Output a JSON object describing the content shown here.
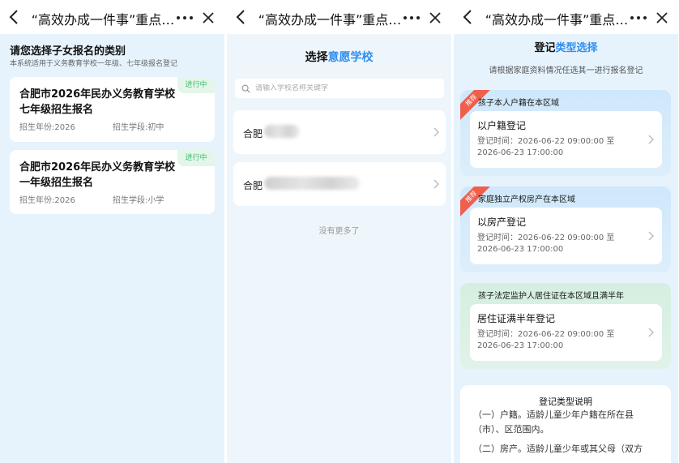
{
  "nav": {
    "title": "“高效办成一件事”重点…"
  },
  "icons": {
    "back": "chevron-left-icon",
    "more": "more-dots-icon",
    "close": "close-icon",
    "search": "search-icon",
    "chevron": "chevron-right-icon"
  },
  "colors": {
    "accent": "#2e8df0",
    "status_green": "#3dbb6a",
    "recommend_red": "#ef5f4c"
  },
  "panel1": {
    "heading": "请您选择子女报名的类别",
    "subheading": "本系统适用于义务教育学校一年级、七年级报名登记",
    "cards": [
      {
        "title": "合肥市2026年民办义务教育学校七年级招生报名",
        "status": "进行中",
        "year": "招生年份:2026",
        "stage": "招生学段:初中"
      },
      {
        "title": "合肥市2026年民办义务教育学校一年级招生报名",
        "status": "进行中",
        "year": "招生年份:2026",
        "stage": "招生学段:小学"
      }
    ]
  },
  "panel2": {
    "title_prefix": "选择",
    "title_highlight": "意愿学校",
    "search_placeholder": "请输入学校名称关键字",
    "schools": [
      {
        "label": "合肥"
      },
      {
        "label": "合肥"
      }
    ],
    "no_more": "没有更多了"
  },
  "panel3": {
    "title_prefix": "登记",
    "title_highlight": "类型选择",
    "subtitle": "请根据家庭资料情况任选其一进行报名登记",
    "options": [
      {
        "header": "孩子本人户籍在本区域",
        "badge": "推荐",
        "name": "以户籍登记",
        "time": "登记时间：2026-06-22 09:00:00 至 2026-06-23 17:00:00"
      },
      {
        "header": "家庭独立产权房产在本区域",
        "badge": "推荐",
        "name": "以房产登记",
        "time": "登记时间：2026-06-22 09:00:00 至 2026-06-23 17:00:00"
      },
      {
        "header": "孩子法定监护人居住证在本区域且满半年",
        "badge": "",
        "name": "居住证满半年登记",
        "time": "登记时间：2026-06-22 09:00:00 至 2026-06-23 17:00:00"
      }
    ],
    "explain_title": "登记类型说明",
    "explain_p1": "（一）户籍。适龄儿童少年户籍在所在县（市）、区范围内。",
    "explain_p2": "（二）房产。适龄儿童少年或其父母（双方"
  }
}
